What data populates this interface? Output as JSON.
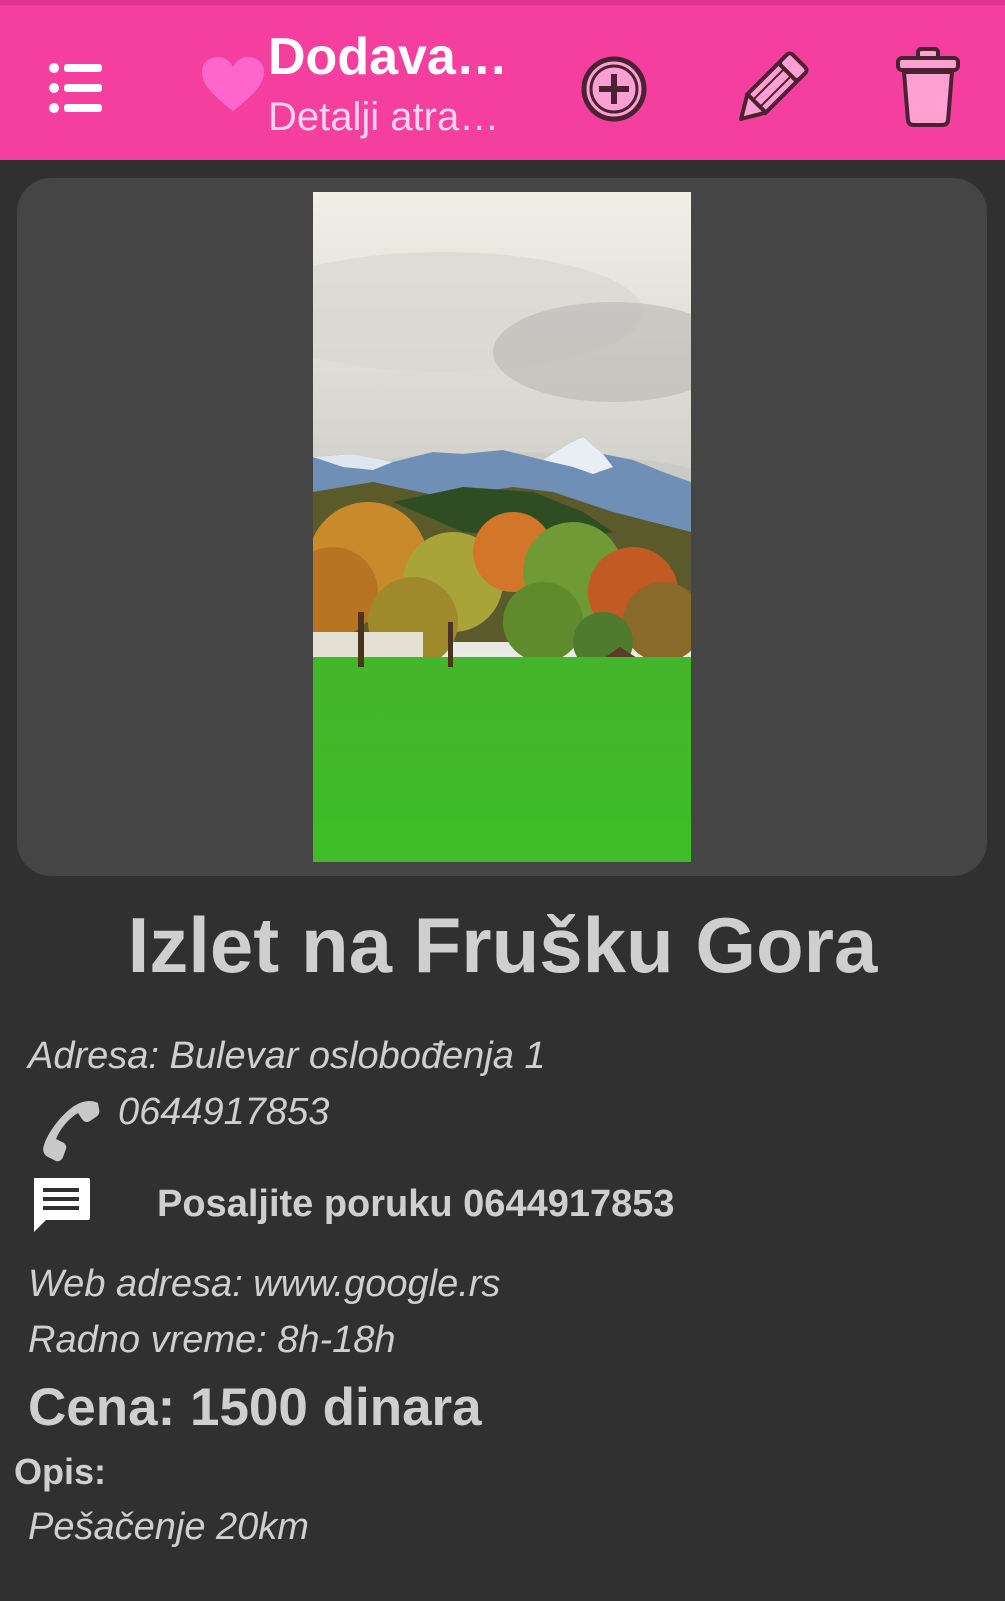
{
  "app_bar": {
    "title": "Dodava…",
    "subtitle": "Detalji atra…",
    "icons": {
      "menu": "list-icon",
      "favorite": "heart-icon",
      "add": "add-circle-icon",
      "edit": "pencil-icon",
      "delete": "trash-icon"
    },
    "background_color": "#f53f9e"
  },
  "attraction": {
    "image_icon": "landscape-photo",
    "title": "Izlet na Frušku Gora",
    "address": "Adresa: Bulevar oslobođenja 1",
    "phone": "0644917853",
    "message": "Posaljite poruku  0644917853",
    "web": "Web adresa: www.google.rs",
    "hours": "Radno vreme: 8h-18h",
    "price": "Cena: 1500 dinara",
    "description_label": "Opis:",
    "description": "Pešačenje 20km"
  },
  "colors": {
    "page_background": "#303030",
    "card_background": "#454545",
    "text": "#cfcfcf",
    "accent": "#f53f9e"
  }
}
